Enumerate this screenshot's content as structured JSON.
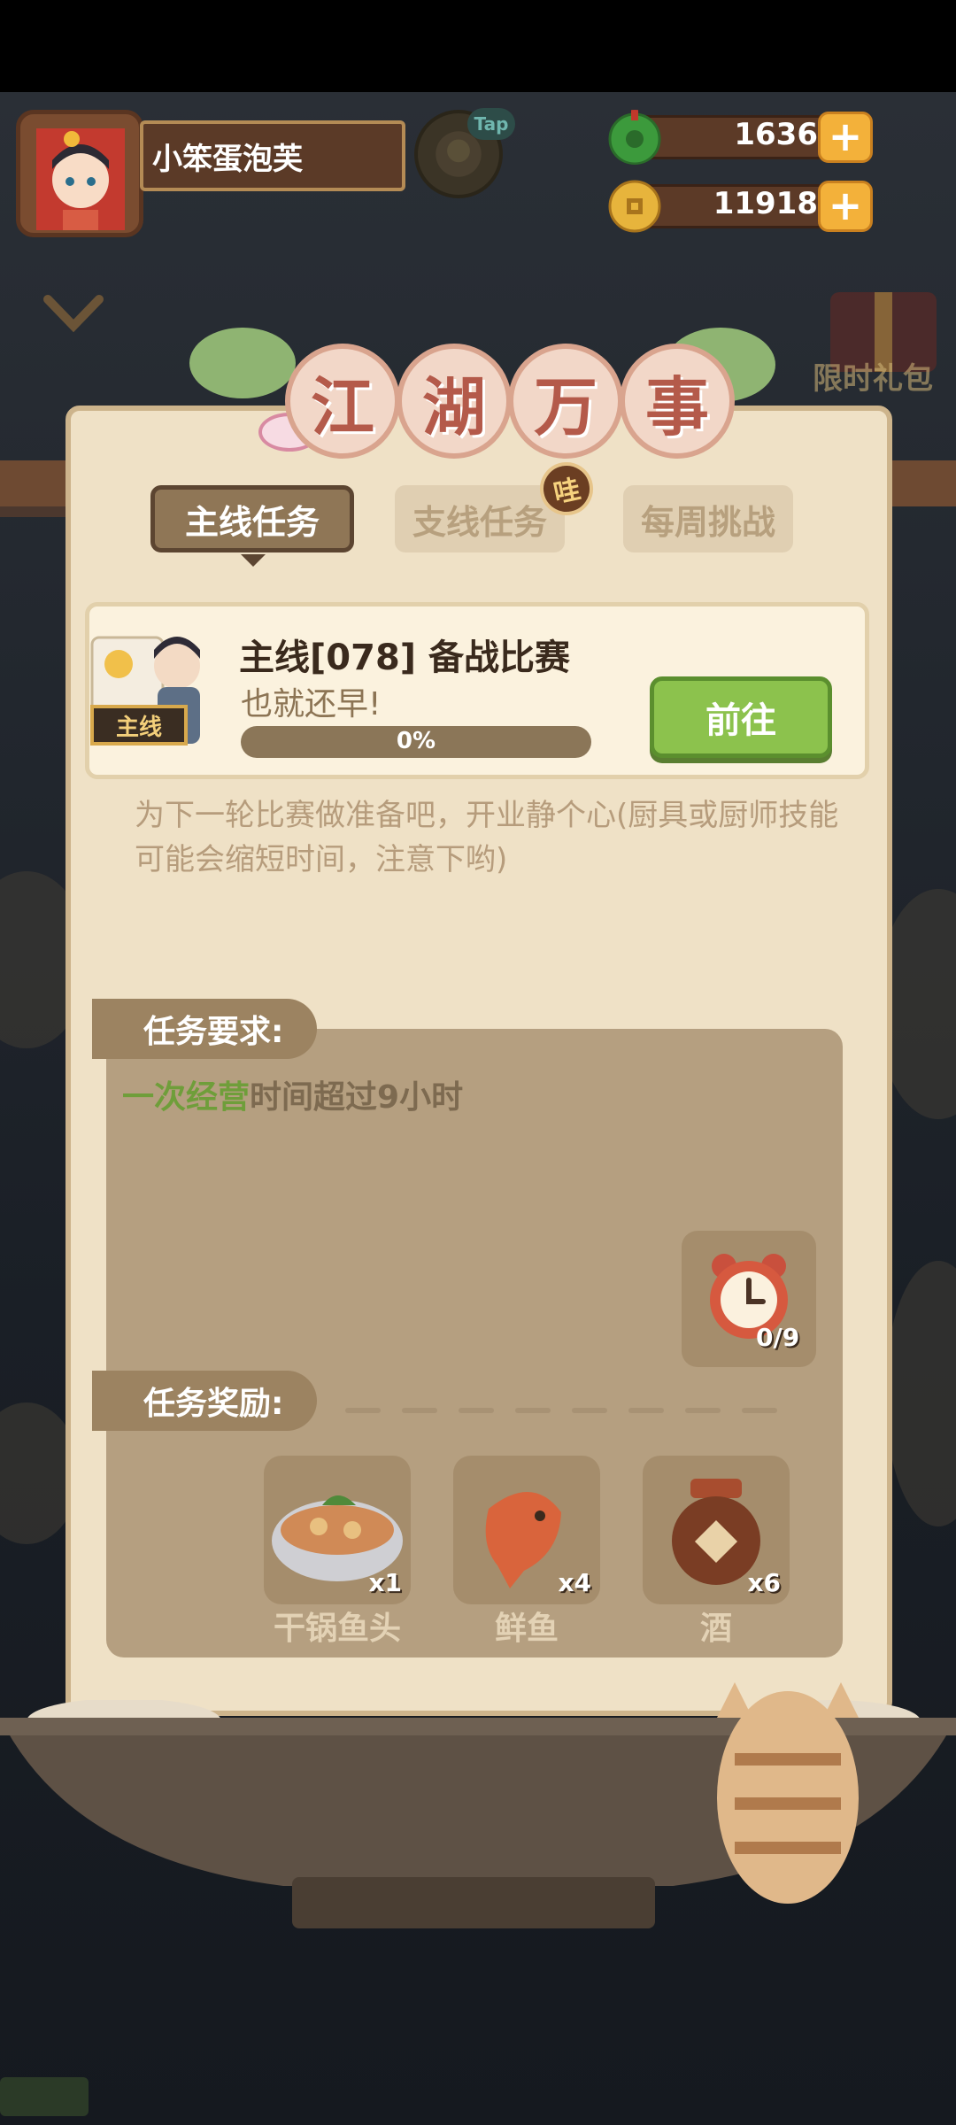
{
  "player": {
    "name": "小笨蛋泡芙"
  },
  "npc_tag": "Tap",
  "currencies": [
    {
      "name": "jade",
      "value": "1636",
      "plus": "+"
    },
    {
      "name": "coin",
      "value": "11918",
      "plus": "+"
    }
  ],
  "side": {
    "gift_label": "限时礼包"
  },
  "banner": {
    "chars": [
      "江",
      "湖",
      "万",
      "事"
    ]
  },
  "tabs": [
    {
      "label": "主线任务",
      "active": true
    },
    {
      "label": "支线任务",
      "active": false,
      "badge": "哇"
    },
    {
      "label": "每周挑战",
      "active": false
    }
  ],
  "task": {
    "tag": "主线",
    "title": "主线[078] 备战比赛",
    "subtitle": "也就还早!",
    "progress_text": "0%",
    "progress": 0,
    "button": "前往",
    "description": "为下一轮比赛做准备吧，开业静个心(厨具或厨师技能可能会缩短时间，注意下哟)"
  },
  "requirements": {
    "title": "任务要求:",
    "highlight": "一次经营",
    "text": "时间超过9小时",
    "counter": "0/9"
  },
  "rewards": {
    "title": "任务奖励:",
    "items": [
      {
        "name": "干锅鱼头",
        "count": "x1"
      },
      {
        "name": "鲜鱼",
        "count": "x4"
      },
      {
        "name": "酒",
        "count": "x6"
      }
    ]
  },
  "colors": {
    "accent_green": "#8cc24d",
    "panel": "#efe1c6",
    "brown": "#5b3a27"
  }
}
